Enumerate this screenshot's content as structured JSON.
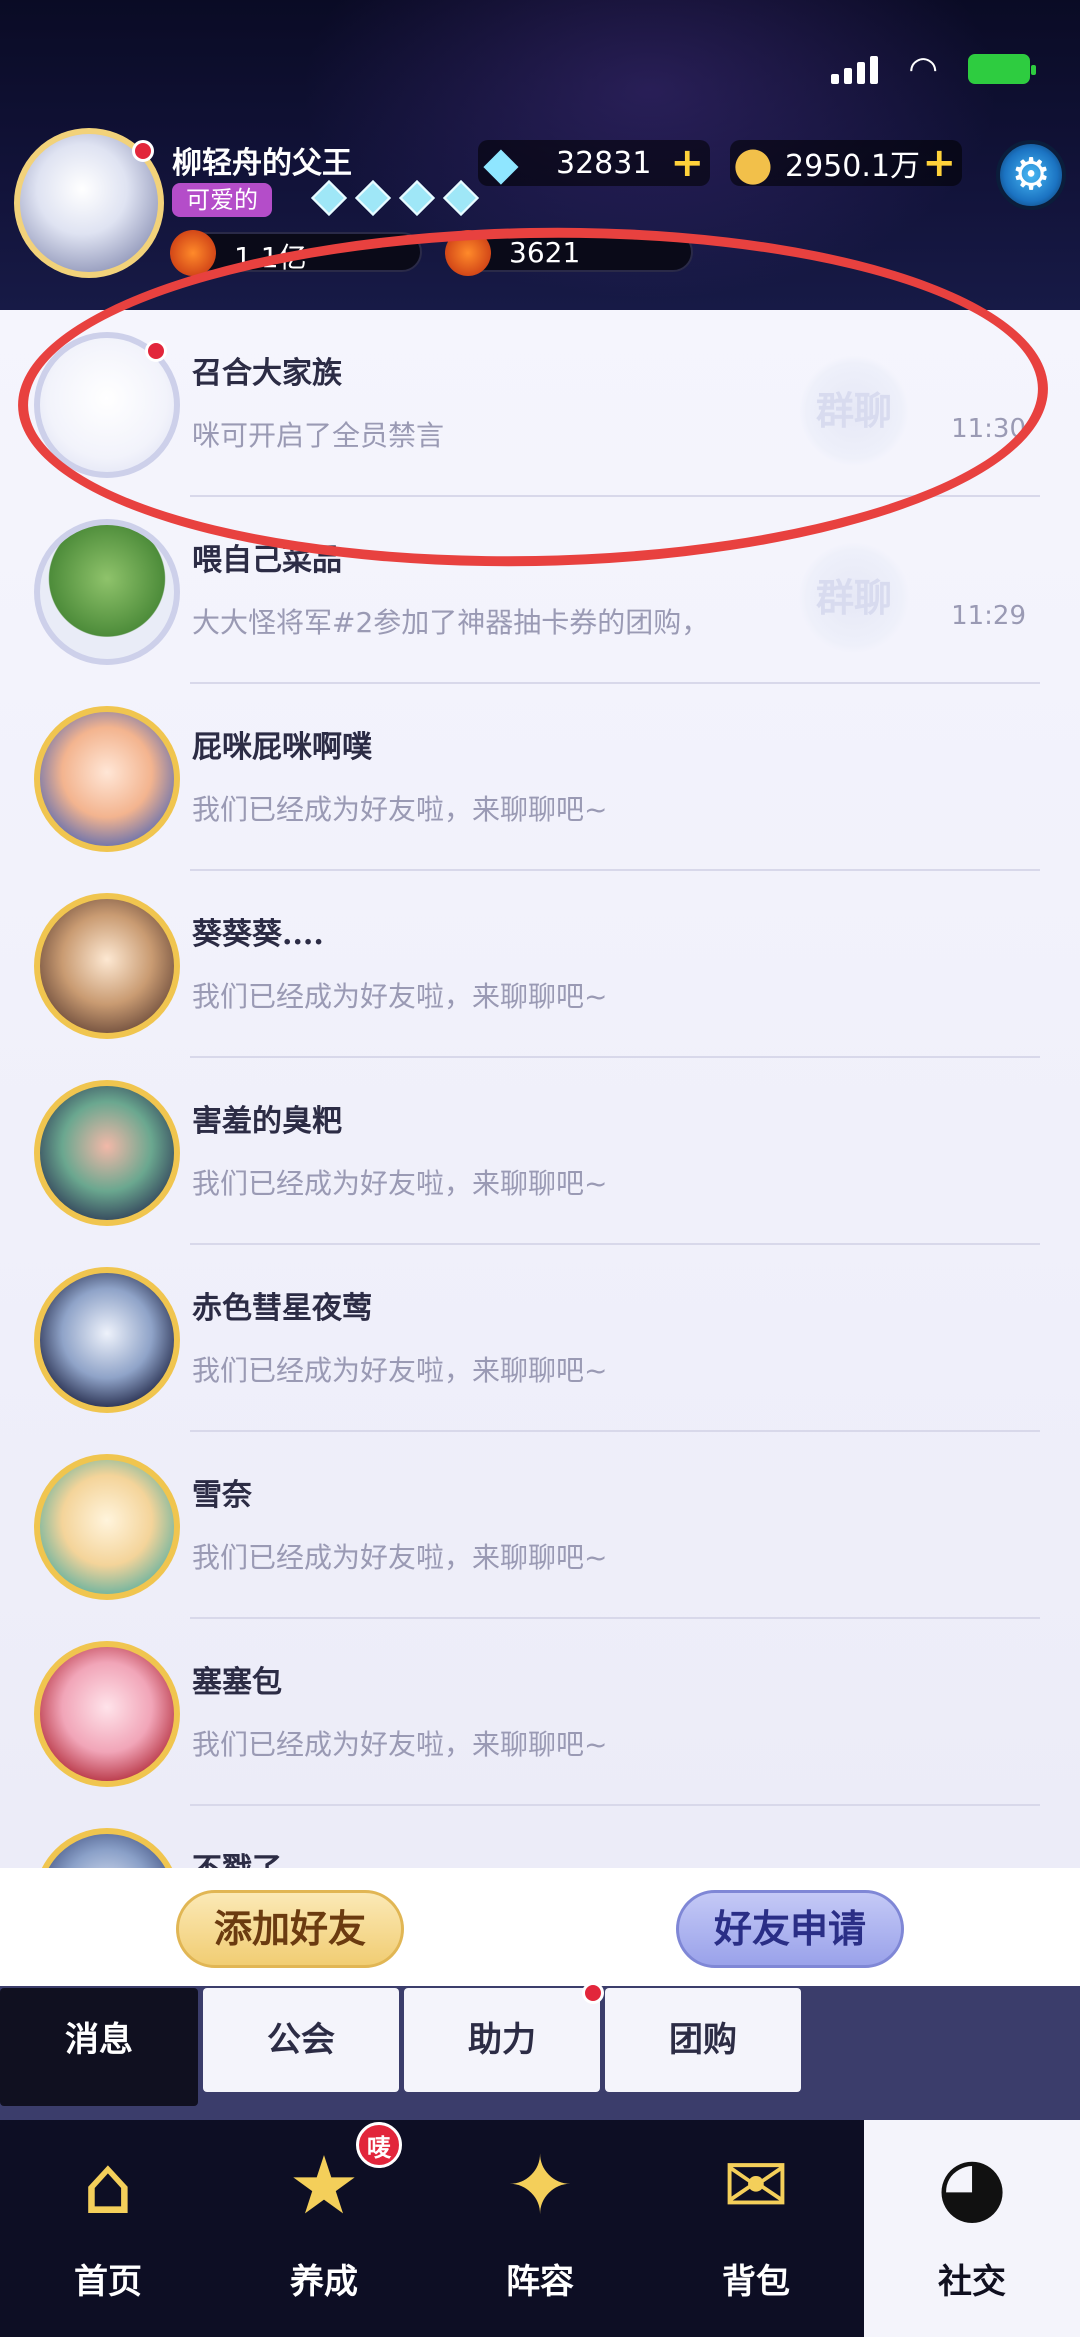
{
  "player": {
    "name": "柳轻舟的父王",
    "title": "可爱的",
    "power": "1.1亿",
    "rank": "3621"
  },
  "currencies": {
    "gems": "32831",
    "coins": "2950.1万"
  },
  "chats": [
    {
      "name": "召合大家族",
      "message": "咪可开启了全员禁言",
      "time": "11:30",
      "tag": "群聊",
      "unread": true,
      "avatar": "group"
    },
    {
      "name": "喂自己菜品",
      "message": "大大怪将军#2参加了神器抽卡券的团购，",
      "time": "11:29",
      "tag": "群聊",
      "unread": false,
      "avatar": "plant"
    },
    {
      "name": "屁咪屁咪啊噗",
      "message": "我们已经成为好友啦，来聊聊吧~",
      "time": "",
      "tag": "",
      "unread": false,
      "avatar": "friend"
    },
    {
      "name": "葵葵葵....",
      "message": "我们已经成为好友啦，来聊聊吧~",
      "time": "",
      "tag": "",
      "unread": false,
      "avatar": "friend"
    },
    {
      "name": "害羞的臭粑",
      "message": "我们已经成为好友啦，来聊聊吧~",
      "time": "",
      "tag": "",
      "unread": false,
      "avatar": "friend"
    },
    {
      "name": "赤色彗星夜莺",
      "message": "我们已经成为好友啦，来聊聊吧~",
      "time": "",
      "tag": "",
      "unread": false,
      "avatar": "friend"
    },
    {
      "name": "雪奈",
      "message": "我们已经成为好友啦，来聊聊吧~",
      "time": "",
      "tag": "",
      "unread": false,
      "avatar": "friend"
    },
    {
      "name": "塞塞包",
      "message": "我们已经成为好友啦，来聊聊吧~",
      "time": "",
      "tag": "",
      "unread": false,
      "avatar": "friend"
    },
    {
      "name": "不戳了",
      "message": "",
      "time": "",
      "tag": "",
      "unread": false,
      "avatar": "friend"
    }
  ],
  "actions": {
    "add_friend": "添加好友",
    "friend_request": "好友申请"
  },
  "subtabs": [
    {
      "label": "消息",
      "active": true,
      "dot": false
    },
    {
      "label": "公会",
      "active": false,
      "dot": false
    },
    {
      "label": "助力",
      "active": false,
      "dot": true
    },
    {
      "label": "团购",
      "active": false,
      "dot": false
    }
  ],
  "nav": [
    {
      "label": "首页",
      "icon": "home-gate-icon",
      "badge": ""
    },
    {
      "label": "养成",
      "icon": "star-upgrade-icon",
      "badge": "唛"
    },
    {
      "label": "阵容",
      "icon": "lineup-shield-icon",
      "badge": ""
    },
    {
      "label": "背包",
      "icon": "backpack-icon",
      "badge": ""
    },
    {
      "label": "社交",
      "icon": "social-chat-icon",
      "badge": ""
    }
  ],
  "colors": {
    "header_bg": "#0a0b25",
    "list_bg": "#f5f5fd",
    "unread_dot": "#e2263b",
    "annotation_circle": "#e8413f",
    "add_button": "#f1cd73",
    "request_button": "#9aa2ea"
  }
}
